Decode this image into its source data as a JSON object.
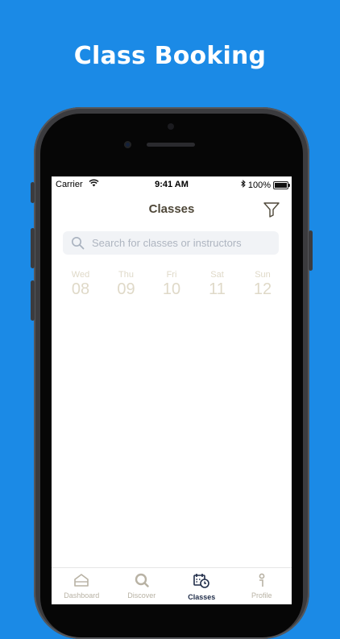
{
  "headline": "Class Booking",
  "status_bar": {
    "carrier": "Carrier",
    "time": "9:41 AM",
    "battery": "100%"
  },
  "nav": {
    "title": "Classes"
  },
  "search": {
    "placeholder": "Search for classes or instructors"
  },
  "days": [
    {
      "name": "Wed",
      "num": "08"
    },
    {
      "name": "Thu",
      "num": "09"
    },
    {
      "name": "Fri",
      "num": "10"
    },
    {
      "name": "Sat",
      "num": "11"
    },
    {
      "name": "Sun",
      "num": "12"
    }
  ],
  "tabs": [
    {
      "label": "Dashboard",
      "icon": "dashboard-icon"
    },
    {
      "label": "Discover",
      "icon": "search-icon"
    },
    {
      "label": "Classes",
      "icon": "calendar-clock-icon",
      "active": true
    },
    {
      "label": "Profile",
      "icon": "person-icon"
    }
  ],
  "colors": {
    "background": "#1b8ae6",
    "title_text": "#4e4738",
    "day_text": "#dfd9c8",
    "active_tab": "#1f2c48",
    "inactive_tab": "#b8b2a4"
  }
}
